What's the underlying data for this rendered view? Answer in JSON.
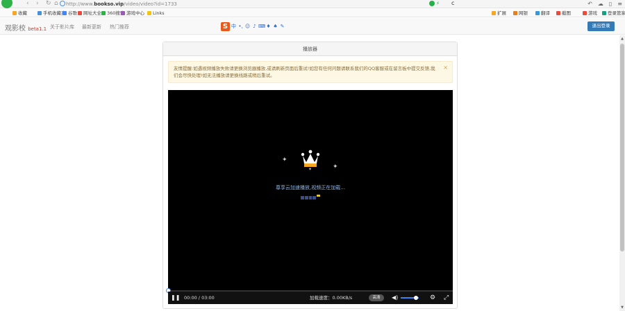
{
  "browser": {
    "url_prefix": "http://www.",
    "url_domain": "bookso.vip",
    "url_path": "/video/video?id=1733",
    "tab_label": "c",
    "nav": {
      "back": "‹",
      "forward": "›",
      "reload": "↻",
      "home": "⌂"
    }
  },
  "bookmarks": [
    {
      "label": "收藏",
      "color": "#f5a623"
    },
    {
      "label": "手机收藏夹",
      "color": "#4a90d9"
    },
    {
      "label": "谷歌",
      "color": "#4285f4"
    },
    {
      "label": "网址大全",
      "color": "#e74c3c"
    },
    {
      "label": "360搜索",
      "color": "#2eb34a"
    },
    {
      "label": "游戏中心",
      "color": "#9b59b6"
    },
    {
      "label": "Links",
      "color": "#f1c40f"
    }
  ],
  "bookmarks_right": [
    {
      "label": "扩展",
      "color": "#f5a623"
    },
    {
      "label": "网银",
      "color": "#e67e22"
    },
    {
      "label": "翻译",
      "color": "#3498db"
    },
    {
      "label": "截图",
      "color": "#e74c3c"
    },
    {
      "label": "游戏",
      "color": "#e74c3c"
    },
    {
      "label": "登录管家",
      "color": "#16a085"
    }
  ],
  "site": {
    "brand": "观影校",
    "version": "beta1.1",
    "nav_links": [
      "关于影片库",
      "最新更新",
      "热门推荐"
    ],
    "login_button": "退出登录"
  },
  "panel": {
    "title": "播放器",
    "alert_text": "友情提醒:如遇视频播放失败请更换浏览器播放,或请刷新页面后重试!如您有任何问题请联系我们的QQ客服或在留言板中提交反馈,我们会尽快处理!如无法播放请更换线路或稍后重试。",
    "alert_close": "×"
  },
  "player": {
    "loading_text": "尊享云加速播放,视频正在加载...",
    "current_time": "00:00",
    "duration": "03:00",
    "time_sep": " / ",
    "speed_text": "加载速度：0.00KB/s",
    "hd_label": "高清",
    "progress": 0.0,
    "volume": 0.85
  }
}
